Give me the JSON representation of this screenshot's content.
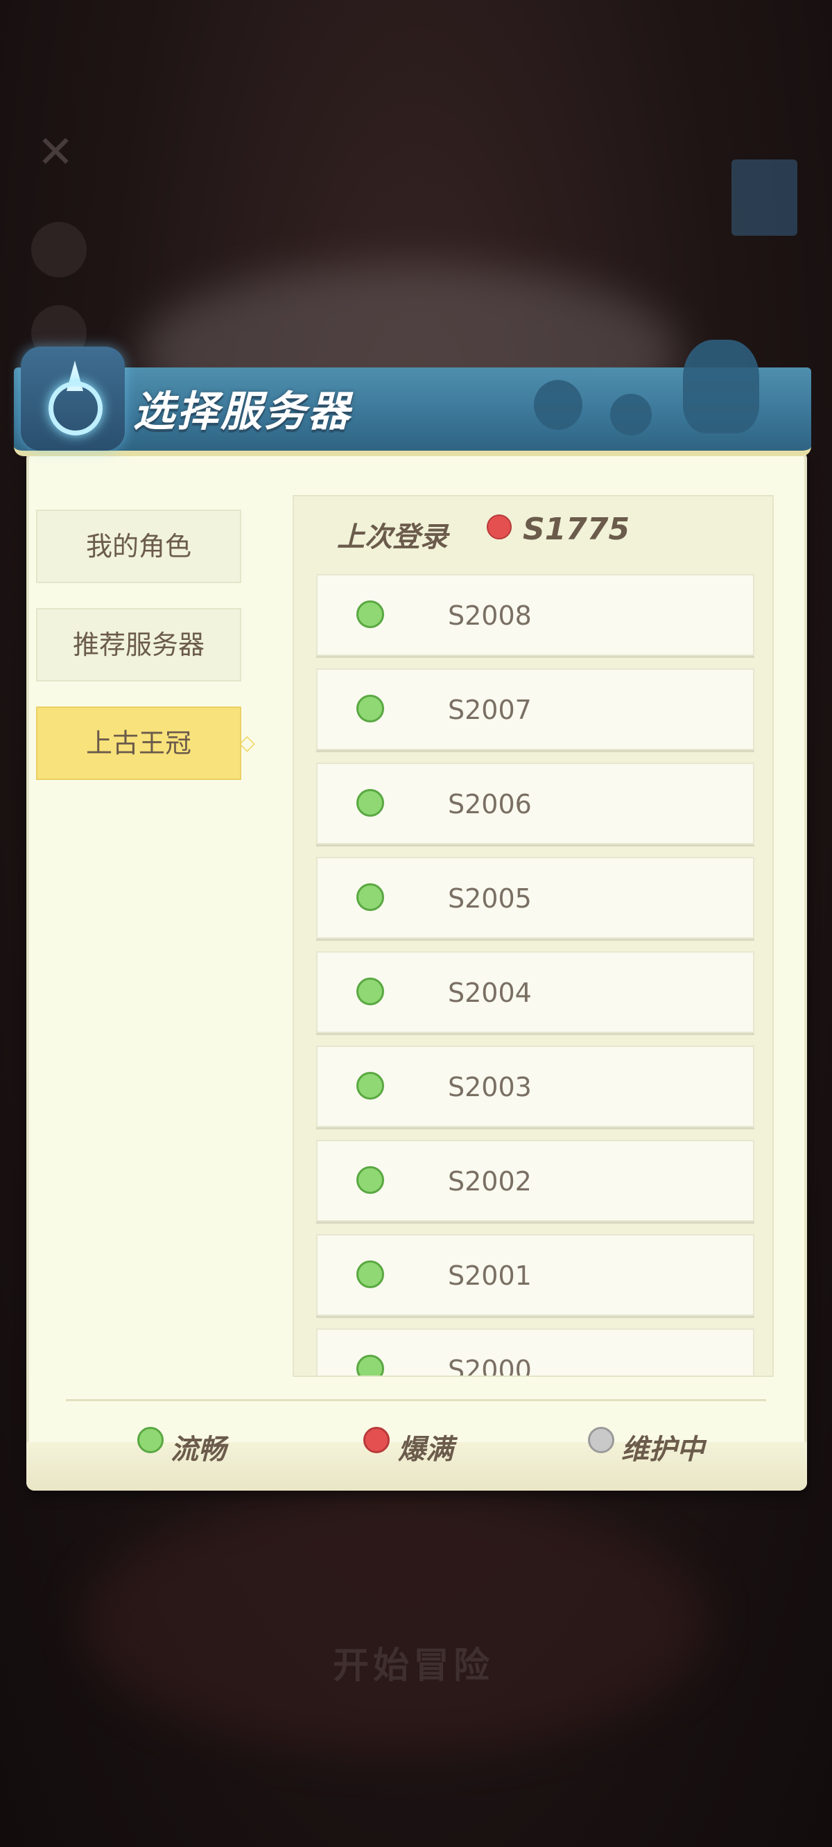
{
  "dialog": {
    "title": "选择服务器"
  },
  "tabs": [
    {
      "label": "我的角色",
      "active": false
    },
    {
      "label": "推荐服务器",
      "active": false
    },
    {
      "label": "上古王冠",
      "active": true
    }
  ],
  "last_login": {
    "label": "上次登录",
    "server": "S1775",
    "status_color": "#e45050"
  },
  "servers": [
    {
      "name": "S2008",
      "status": "green"
    },
    {
      "name": "S2007",
      "status": "green"
    },
    {
      "name": "S2006",
      "status": "green"
    },
    {
      "name": "S2005",
      "status": "green"
    },
    {
      "name": "S2004",
      "status": "green"
    },
    {
      "name": "S2003",
      "status": "green"
    },
    {
      "name": "S2002",
      "status": "green"
    },
    {
      "name": "S2001",
      "status": "green"
    },
    {
      "name": "S2000",
      "status": "green"
    }
  ],
  "legend": [
    {
      "label": "流畅",
      "color": "#8fd873"
    },
    {
      "label": "爆满",
      "color": "#e45050"
    },
    {
      "label": "维护中",
      "color": "#c9c9c9"
    }
  ],
  "background": {
    "start_label": "开始冒险"
  },
  "colors": {
    "banner": "#3a7597",
    "active_tab": "#f8e27b",
    "panel": "#f1f2d8"
  }
}
